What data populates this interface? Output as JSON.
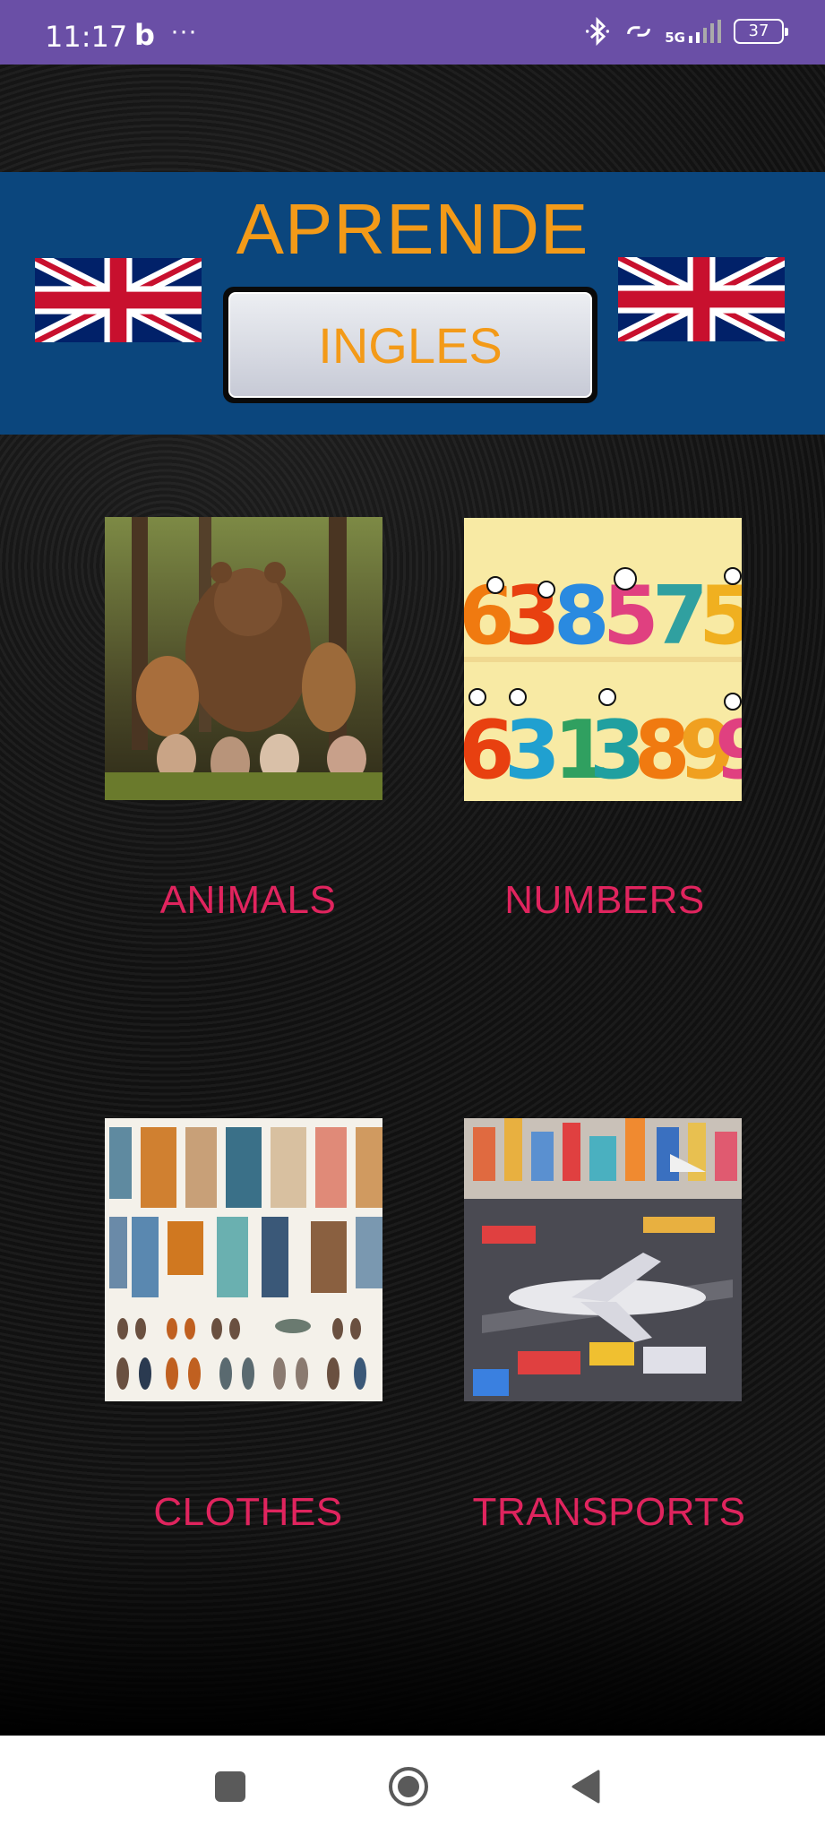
{
  "status_bar": {
    "time": "11:17",
    "app_badge": "b",
    "more": "···",
    "network": "5G",
    "battery": "37"
  },
  "header": {
    "title": "APRENDE",
    "subtitle": "INGLES"
  },
  "categories": [
    {
      "label": "ANIMALS",
      "image": "animals-forest-image"
    },
    {
      "label": "NUMBERS",
      "image": "cartoon-numbers-image"
    },
    {
      "label": "CLOTHES",
      "image": "clothes-collection-image"
    },
    {
      "label": "TRANSPORTS",
      "image": "toy-transport-city-image"
    }
  ],
  "nav_bar": {
    "icons": [
      "recents-square-icon",
      "home-circle-icon",
      "back-triangle-icon"
    ]
  },
  "colors": {
    "status_bar": "#6a4fa6",
    "header_band": "#0b467d",
    "title_orange": "#f39a18",
    "label_pink": "#e0245e"
  }
}
